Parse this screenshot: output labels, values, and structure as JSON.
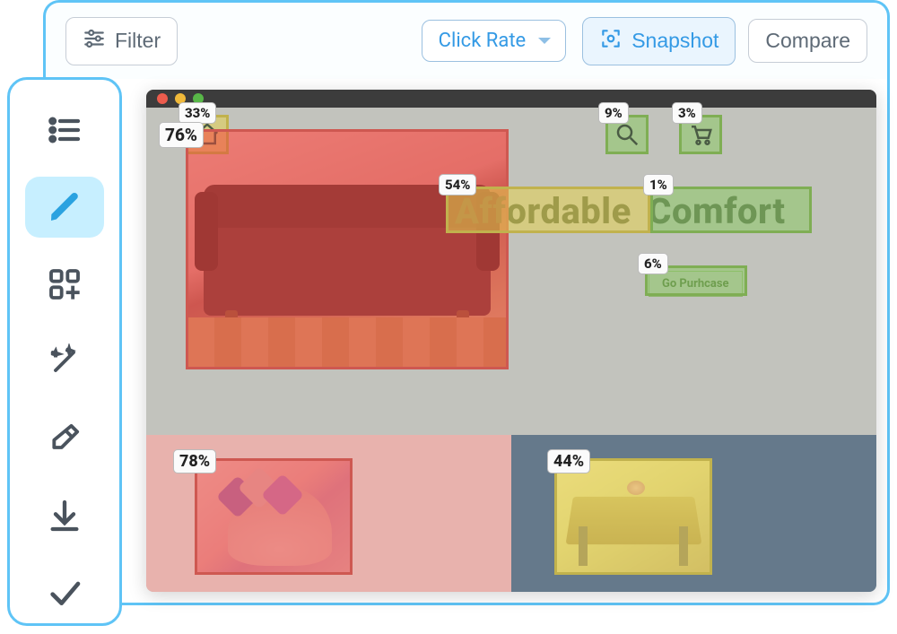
{
  "toolbar": {
    "filter_label": "Filter",
    "dropdown_label": "Click Rate",
    "snapshot_label": "Snapshot",
    "compare_label": "Compare"
  },
  "tools": [
    "list",
    "pencil",
    "widgets",
    "wand",
    "eraser",
    "download",
    "check"
  ],
  "mock_site": {
    "tagline_a": "Affordable",
    "tagline_b": "Comfort",
    "cta": "Go Purhcase"
  },
  "heat": {
    "home": {
      "pct": "33%"
    },
    "search": {
      "pct": "9%"
    },
    "cart": {
      "pct": "3%"
    },
    "hero": {
      "pct": "76%"
    },
    "tag_a": {
      "pct": "54%"
    },
    "tag_b": {
      "pct": "1%"
    },
    "cta": {
      "pct": "6%"
    },
    "card_left": {
      "pct": "78%"
    },
    "card_right": {
      "pct": "44%"
    }
  }
}
